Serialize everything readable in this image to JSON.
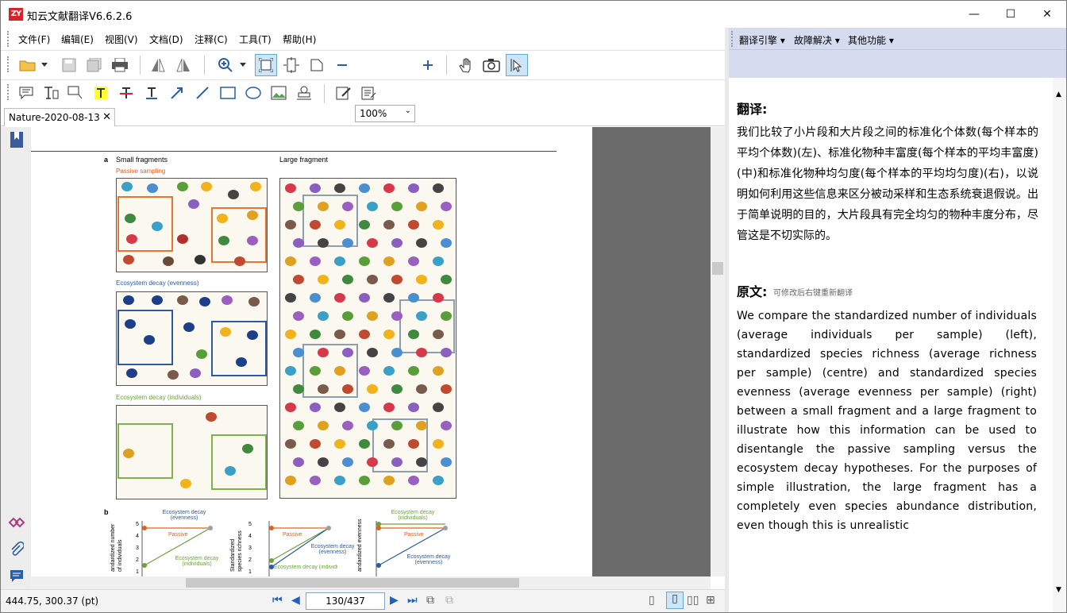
{
  "app": {
    "logo_text": "ZY",
    "title": "知云文献翻译V6.6.2.6",
    "controls": {
      "minimize": "—",
      "maximize": "☐",
      "close": "✕"
    }
  },
  "menu": [
    "文件(F)",
    "编辑(E)",
    "视图(V)",
    "文档(D)",
    "注释(C)",
    "工具(T)",
    "帮助(H)"
  ],
  "toolbar": {
    "zoom_value": "100%"
  },
  "document_tab": {
    "label": "Nature-2020-08-13",
    "close": "✕"
  },
  "figure": {
    "label_a": "a",
    "small_fragments": "Small fragments",
    "large_fragment": "Large fragment",
    "passive_sampling": "Passive sampling",
    "decay_evenness": "Ecosystem decay (evenness)",
    "decay_individuals": "Ecosystem decay (individuals)",
    "label_b": "b",
    "graph1": {
      "ylabel_line1": "andardized number",
      "ylabel_line2": "of individuals",
      "ticks": [
        "5",
        "4",
        "3",
        "2",
        "1"
      ],
      "top_label": "Ecosystem decay (evenness)",
      "mid_label": "Passive",
      "bottom_label": "Ecosystem decay (individuals)"
    },
    "graph2": {
      "ylabel_line1": "Standardized",
      "ylabel_line2": "species richness",
      "ticks": [
        "5",
        "4",
        "3",
        "2",
        "1"
      ],
      "mid_label": "Passive",
      "label_a": "Ecosystem decay (evenness)",
      "label_b": "Ecosystem decay (individuals)"
    },
    "graph3": {
      "ylabel_line1": "andardized evenness",
      "top_label": "Ecosystem decay (individuals)",
      "mid_label": "Passive",
      "bottom_label": "Ecosystem decay (evenness)"
    }
  },
  "status": {
    "coords": "444.75, 300.37 (pt)",
    "page": "130/437"
  },
  "right_panel": {
    "menus": [
      "翻译引擎",
      "故障解决",
      "其他功能"
    ],
    "translation_heading": "翻译:",
    "translation_text": "我们比较了小片段和大片段之间的标准化个体数(每个样本的平均个体数)(左)、标准化物种丰富度(每个样本的平均丰富度)(中)和标准化物种均匀度(每个样本的平均均匀度)(右)，以说明如何利用这些信息来区分被动采样和生态系统衰退假说。出于简单说明的目的，大片段具有完全均匀的物种丰度分布，尽管这是不切实际的。",
    "original_heading": "原文:",
    "original_hint": "可修改后右键重新翻译",
    "original_text": "We compare the standardized number of individuals (average individuals per sample) (left), standardized species richness (average richness per sample) (centre) and standardized species evenness (average evenness per sample) (right) between a small fragment and a large fragment to illustrate how this information can be used to disentangle the passive sampling versus the ecosystem decay hypotheses. For the purposes of simple illustration, the large fragment has a completely even species abundance distribution, even though this is unrealistic"
  }
}
